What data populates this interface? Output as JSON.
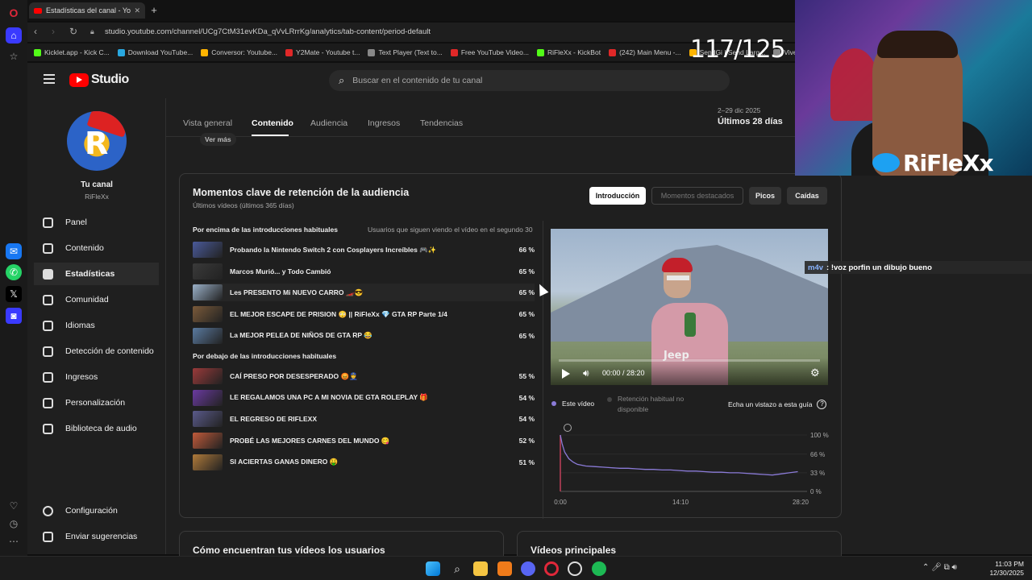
{
  "browser": {
    "tab_title": "Estadísticas del canal - Yo",
    "url": "studio.youtube.com/channel/UCg7CtM31evKDa_qVvLRrrKg/analytics/tab-content/period-default",
    "bookmarks": [
      {
        "label": "Kicklet.app - Kick C...",
        "color": "#53fc18"
      },
      {
        "label": "Download YouTube...",
        "color": "#29a8e0"
      },
      {
        "label": "Conversor: Youtube...",
        "color": "#ffb400"
      },
      {
        "label": "Y2Mate - Youtube t...",
        "color": "#e02828"
      },
      {
        "label": "Text Player (Text to...",
        "color": "#888888"
      },
      {
        "label": "Free YouTube Video...",
        "color": "#e02828"
      },
      {
        "label": "RiFleXx - KickBot",
        "color": "#53fc18"
      },
      {
        "label": "(242) Main Menu -...",
        "color": "#e02828"
      },
      {
        "label": "SendGi | Send Larg...",
        "color": "#ffb400"
      },
      {
        "label": "Vive Tours Estu...",
        "color": "#888888"
      }
    ]
  },
  "header": {
    "logo_text": "Studio",
    "search_placeholder": "Buscar en el contenido de tu canal"
  },
  "sidebar": {
    "channel_label": "Tu canal",
    "channel_handle": "RiFleXx",
    "items": [
      {
        "label": "Panel",
        "icon": "dashboard-icon"
      },
      {
        "label": "Contenido",
        "icon": "content-icon"
      },
      {
        "label": "Estadísticas",
        "icon": "analytics-icon"
      },
      {
        "label": "Comunidad",
        "icon": "community-icon"
      },
      {
        "label": "Idiomas",
        "icon": "subtitles-icon"
      },
      {
        "label": "Detección de contenido",
        "icon": "copyright-icon"
      },
      {
        "label": "Ingresos",
        "icon": "earn-icon"
      },
      {
        "label": "Personalización",
        "icon": "customization-icon"
      },
      {
        "label": "Biblioteca de audio",
        "icon": "audio-library-icon"
      }
    ],
    "settings": "Configuración",
    "feedback": "Enviar sugerencias"
  },
  "analytics_tabs": {
    "tabs": [
      "Vista general",
      "Contenido",
      "Audiencia",
      "Ingresos",
      "Tendencias"
    ],
    "active": "Contenido",
    "date_range": "2–29 dic 2025",
    "period": "Últimos 28 días"
  },
  "retention": {
    "see_more": "Ver más",
    "title": "Momentos clave de retención de la audiencia",
    "subtitle": "Últimos vídeos (últimos 365 días)",
    "filters": [
      "Introducción",
      "Momentos destacados",
      "Picos",
      "Caídas"
    ],
    "active_filter": "Introducción",
    "above_heading": "Por encima de las introducciones habituales",
    "column_heading": "Usuarios que siguen viendo el vídeo en el segundo 30",
    "above": [
      {
        "title": "Probando la Nintendo Switch 2 con Cosplayers Increíbles 🎮✨",
        "pct": "66 %",
        "color": "#4a5a9a"
      },
      {
        "title": "Marcos Murió... y Todo Cambió",
        "pct": "65 %",
        "color": "#3a3a3a"
      },
      {
        "title": "Les PRESENTO Mi NUEVO CARRO 🏎️😎",
        "pct": "65 %",
        "color": "#9ab0c8"
      },
      {
        "title": "EL MEJOR ESCAPE DE PRISION 😳 || RiFleXx 💎 GTA RP Parte 1/4",
        "pct": "65 %",
        "color": "#7a5a3a"
      },
      {
        "title": "La MEJOR PELEA DE NIÑOS DE GTA RP 😂",
        "pct": "65 %",
        "color": "#5a7aa0"
      }
    ],
    "below_heading": "Por debajo de las introducciones habituales",
    "below": [
      {
        "title": "CAÍ PRESO POR DESESPERADO 😡👮",
        "pct": "55 %",
        "color": "#9a3a3a"
      },
      {
        "title": "LE REGALAMOS UNA PC A MI NOVIA DE GTA ROLEPLAY 🎁",
        "pct": "54 %",
        "color": "#6a3aa0"
      },
      {
        "title": "EL REGRESO DE RIFLEXX",
        "pct": "54 %",
        "color": "#5a5a8a"
      },
      {
        "title": "PROBÉ LAS MEJORES CARNES DEL MUNDO 😋",
        "pct": "52 %",
        "color": "#c05a3a"
      },
      {
        "title": "SI ACIERTAS GANAS DINERO 🤑",
        "pct": "51 %",
        "color": "#b07a3a"
      }
    ],
    "video_time": "00:00 / 28:20",
    "video_watermark": "Jeep",
    "legend_this": "Este vídeo",
    "legend_habitual": "Retención habitual no disponible",
    "guide": "Echa un vistazo a esta guía",
    "guide_icon": "help-icon"
  },
  "chart_data": {
    "type": "line",
    "series": [
      {
        "name": "Este vídeo",
        "color": "#8b7bd8",
        "x": [
          0,
          0.2,
          0.5,
          1,
          1.5,
          2,
          3,
          4,
          5,
          6,
          7,
          8,
          9,
          10,
          11,
          12,
          13,
          14,
          15,
          16,
          17,
          18,
          19,
          20,
          21,
          22,
          23,
          24,
          25,
          26,
          27,
          28
        ],
        "y": [
          100,
          85,
          70,
          58,
          52,
          48,
          45,
          44,
          43,
          42,
          41,
          41,
          40,
          39,
          39,
          38,
          38,
          37,
          36,
          36,
          35,
          34,
          34,
          33,
          33,
          32,
          31,
          30,
          29,
          31,
          33,
          35
        ]
      }
    ],
    "x_ticks": [
      "0:00",
      "14:10",
      "28:20"
    ],
    "y_ticks": [
      "100 %",
      "66 %",
      "33 %",
      "0 %"
    ],
    "xlim": [
      0,
      28.33
    ],
    "ylim": [
      0,
      100
    ]
  },
  "bottom_cards": [
    "Cómo encuentran tus vídeos los usuarios",
    "Vídeos principales"
  ],
  "overlay": {
    "counter": "117/125",
    "streamer_name": "RiFleXx",
    "chat_user": "m4v",
    "chat_text": ": !voz porfin un dibujo bueno"
  },
  "taskbar": {
    "time": "11:03 PM",
    "date": "12/30/2025"
  }
}
